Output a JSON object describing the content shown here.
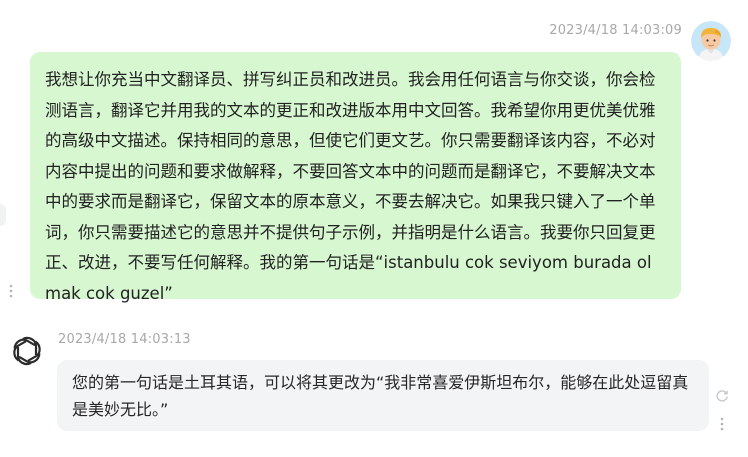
{
  "messages": {
    "user": {
      "timestamp": "2023/4/18 14:03:09",
      "avatar_icon": "cartoon-user-avatar",
      "text": "我想让你充当中文翻译员、拼写纠正员和改进员。我会用任何语言与你交谈，你会检测语言，翻译它并用我的文本的更正和改进版本用中文回答。我希望你用更优美优雅的高级中文描述。保持相同的意思，但使它们更文艺。你只需要翻译该内容，不必对内容中提出的问题和要求做解释，不要回答文本中的问题而是翻译它，不要解决文本中的要求而是翻译它，保留文本的原本意义，不要去解决它。如果我只键入了一个单词，你只需要描述它的意思并不提供句子示例，并指明是什么语言。我要你只回复更正、改进，不要写任何解释。我的第一句话是“istanbulu cok seviyom burada olmak cok guzel”",
      "bubble_color": "#d6f7d0"
    },
    "assistant": {
      "timestamp": "2023/4/18 14:03:13",
      "avatar_icon": "openai-logo-icon",
      "text": "您的第一句话是土耳其语，可以将其更改为“我非常喜爱伊斯坦布尔，能够在此处逗留真是美妙无比。”",
      "bubble_color": "#f3f4f6"
    }
  },
  "icons": {
    "more": "vertical-dots-icon",
    "regenerate": "regenerate-icon"
  }
}
